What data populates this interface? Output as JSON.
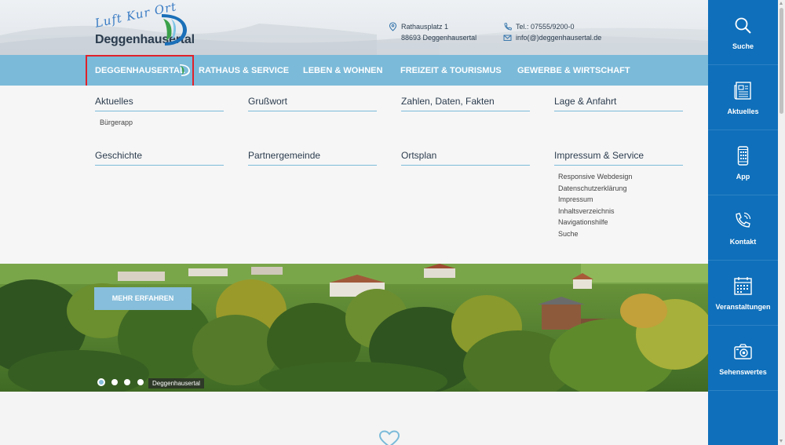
{
  "logo": {
    "script_text": "Luft Kur Ort",
    "name": "Deggenhausertal"
  },
  "contact": {
    "address_line1": "Rathausplatz 1",
    "address_line2": "88693 Deggenhausertal",
    "phone": "Tel.: 07555/9200-0",
    "email": "info(@)deggenhausertal.de"
  },
  "nav": {
    "items": [
      {
        "label": "Deggenhausertal",
        "active": true
      },
      {
        "label": "Rathaus & Service"
      },
      {
        "label": "Leben & Wohnen"
      },
      {
        "label": "Freizeit & Tourismus"
      },
      {
        "label": "Gewerbe & Wirtschaft"
      }
    ]
  },
  "mega_menu": {
    "columns": [
      {
        "heading": "Aktuelles",
        "items": [
          "Bürgerapp"
        ]
      },
      {
        "heading": "Grußwort",
        "items": []
      },
      {
        "heading": "Zahlen, Daten, Fakten",
        "items": []
      },
      {
        "heading": "Lage & Anfahrt",
        "items": []
      },
      {
        "heading": "Geschichte",
        "items": []
      },
      {
        "heading": "Partnergemeinde",
        "items": []
      },
      {
        "heading": "Ortsplan",
        "items": []
      },
      {
        "heading": "Impressum & Service",
        "items": [
          "Responsive Webdesign",
          "Datenschutzerklärung",
          "Impressum",
          "Inhaltsverzeichnis",
          "Navigationshilfe",
          "Suche"
        ]
      }
    ]
  },
  "hero": {
    "cta_label": "Mehr erfahren",
    "caption": "Deggenhausertal",
    "slides_count": 4,
    "active_slide": 1
  },
  "sidebar": {
    "items": [
      {
        "label": "Suche",
        "icon": "search-icon"
      },
      {
        "label": "Aktuelles",
        "icon": "newspaper-icon"
      },
      {
        "label": "App",
        "icon": "smartphone-icon"
      },
      {
        "label": "Kontakt",
        "icon": "phone-icon"
      },
      {
        "label": "Veranstaltungen",
        "icon": "calendar-icon"
      },
      {
        "label": "Sehenswertes",
        "icon": "camera-icon"
      }
    ]
  },
  "colors": {
    "nav_bg": "#7bbad9",
    "sidebar_bg": "#0f6fba",
    "text_dark": "#2b3c4e",
    "highlight": "#e0212b"
  }
}
